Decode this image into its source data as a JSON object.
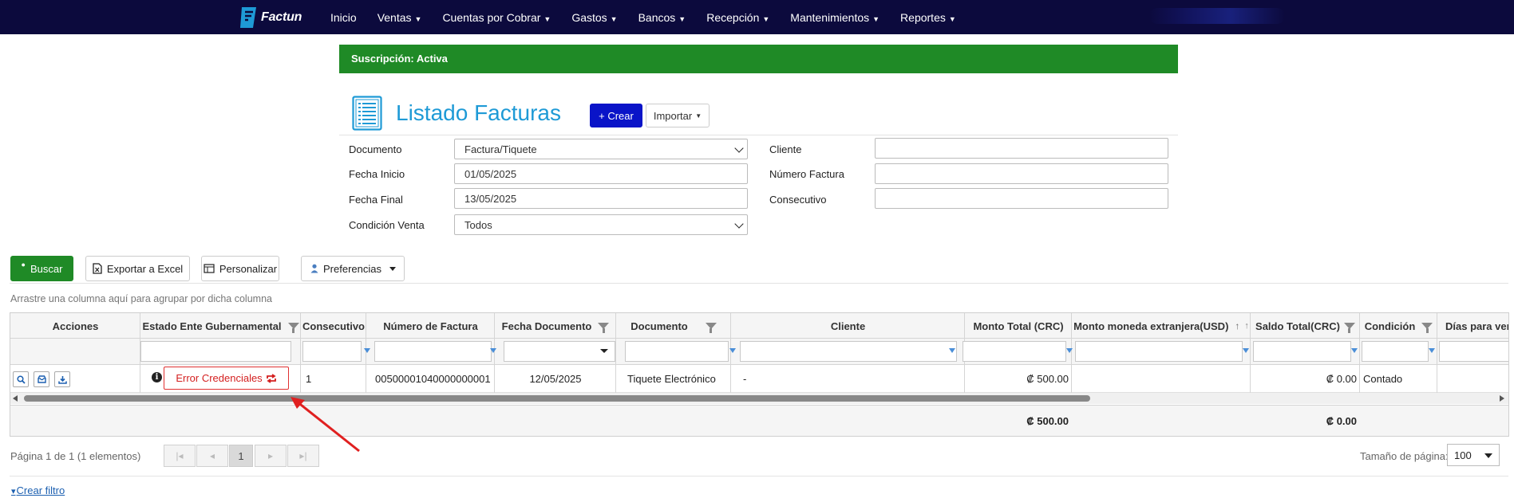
{
  "nav": {
    "brand": "Factun",
    "items": [
      {
        "label": "Inicio",
        "caret": false
      },
      {
        "label": "Ventas",
        "caret": true
      },
      {
        "label": "Cuentas por Cobrar",
        "caret": true
      },
      {
        "label": "Gastos",
        "caret": true
      },
      {
        "label": "Bancos",
        "caret": true
      },
      {
        "label": "Recepción",
        "caret": true
      },
      {
        "label": "Mantenimientos",
        "caret": true
      },
      {
        "label": "Reportes",
        "caret": true
      }
    ]
  },
  "subscription": "Suscripción: Activa",
  "page": {
    "title": "Listado Facturas",
    "create_label": "+ Crear",
    "import_label": "Importar"
  },
  "filters": {
    "documento_label": "Documento",
    "documento_value": "Factura/Tiquete",
    "fecha_inicio_label": "Fecha Inicio",
    "fecha_inicio_value": "01/05/2025",
    "fecha_final_label": "Fecha Final",
    "fecha_final_value": "13/05/2025",
    "condicion_label": "Condición Venta",
    "condicion_value": "Todos",
    "cliente_label": "Cliente",
    "cliente_value": "",
    "numero_label": "Número Factura",
    "numero_value": "",
    "consecutivo_label": "Consecutivo",
    "consecutivo_value": ""
  },
  "toolbar": {
    "buscar": "Buscar",
    "exportar": "Exportar a Excel",
    "personalizar": "Personalizar",
    "preferencias": "Preferencias"
  },
  "grid": {
    "group_hint": "Arrastre una columna aquí para agrupar por dicha columna",
    "columns": {
      "acciones": "Acciones",
      "estado": "Estado Ente Gubernamental",
      "consecutivo": "Consecutivo",
      "numero": "Número de Factura",
      "fecha": "Fecha Documento",
      "documento": "Documento",
      "cliente": "Cliente",
      "monto_total": "Monto Total (CRC)",
      "monto_ext": "Monto moneda extranjera(USD)",
      "saldo": "Saldo Total(CRC)",
      "condicion": "Condición",
      "dias": "Días para ven"
    },
    "row": {
      "estado": "Error Credenciales",
      "consecutivo": "1",
      "numero": "00500001040000000001",
      "fecha": "12/05/2025",
      "documento": "Tiquete Electrónico",
      "cliente": "-",
      "monto_total": "₡ 500.00",
      "monto_ext": "",
      "saldo": "₡ 0.00",
      "condicion": "Contado",
      "dias": ""
    },
    "footer": {
      "monto_total": "₡ 500.00",
      "saldo": "₡ 0.00"
    }
  },
  "pager": {
    "info": "Página 1 de 1 (1 elementos)",
    "current_page": "1",
    "size_label": "Tamaño de página:",
    "size_value": "100"
  },
  "crear_filtro": "Crear filtro",
  "colors": {
    "nav_bg": "#0c0a3d",
    "banner_green": "#1f8a26",
    "title_blue": "#1e9ad6",
    "create_blue": "#0a14c8",
    "error_red": "#d42020",
    "annotation_red": "#e02020"
  }
}
